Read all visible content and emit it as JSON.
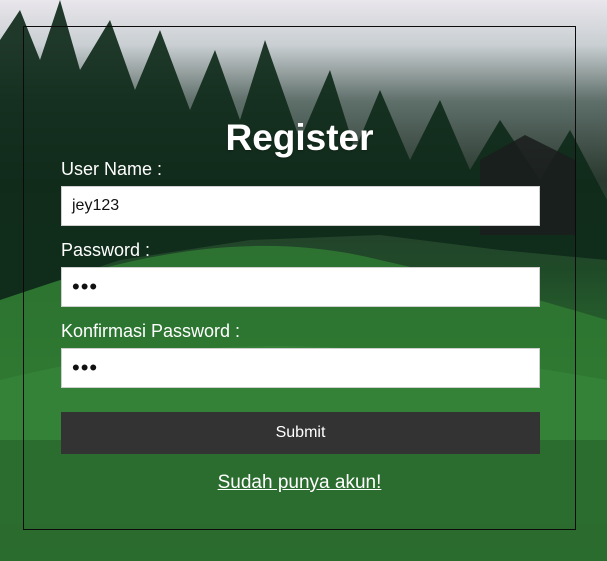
{
  "form": {
    "title": "Register",
    "username_label": "User Name :",
    "username_value": "jey123",
    "password_label": "Password :",
    "password_mask": "•••",
    "confirm_label": "Konfirmasi Password :",
    "confirm_mask": "•••",
    "submit_label": "Submit",
    "login_link": "Sudah punya akun!"
  },
  "colors": {
    "title_text": "#ffffff",
    "button_bg": "#333333",
    "input_bg": "#ffffff"
  }
}
